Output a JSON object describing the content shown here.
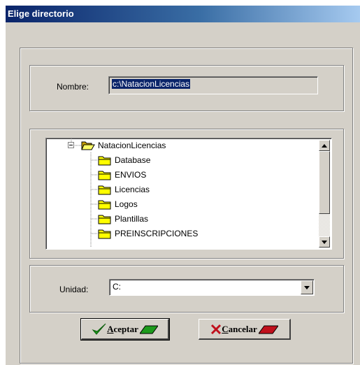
{
  "window": {
    "title": "Elige directorio"
  },
  "nombre": {
    "label": "Nombre:",
    "value": "c:\\NatacionLicencias"
  },
  "tree": {
    "root": "NatacionLicencias",
    "children": [
      "Database",
      "ENVIOS",
      "Licencias",
      "Logos",
      "Plantillas",
      "PREINSCRIPCIONES"
    ]
  },
  "unidad": {
    "label": "Unidad:",
    "value": "C:"
  },
  "buttons": {
    "aceptar": {
      "mnemonic": "A",
      "rest": "ceptar"
    },
    "cancelar": {
      "mnemonic": "C",
      "rest": "ancelar"
    }
  },
  "colors": {
    "ok": "#1c9a1c",
    "cancel": "#c0101c",
    "folder": "#ffff00",
    "selection": "#0a246a"
  }
}
